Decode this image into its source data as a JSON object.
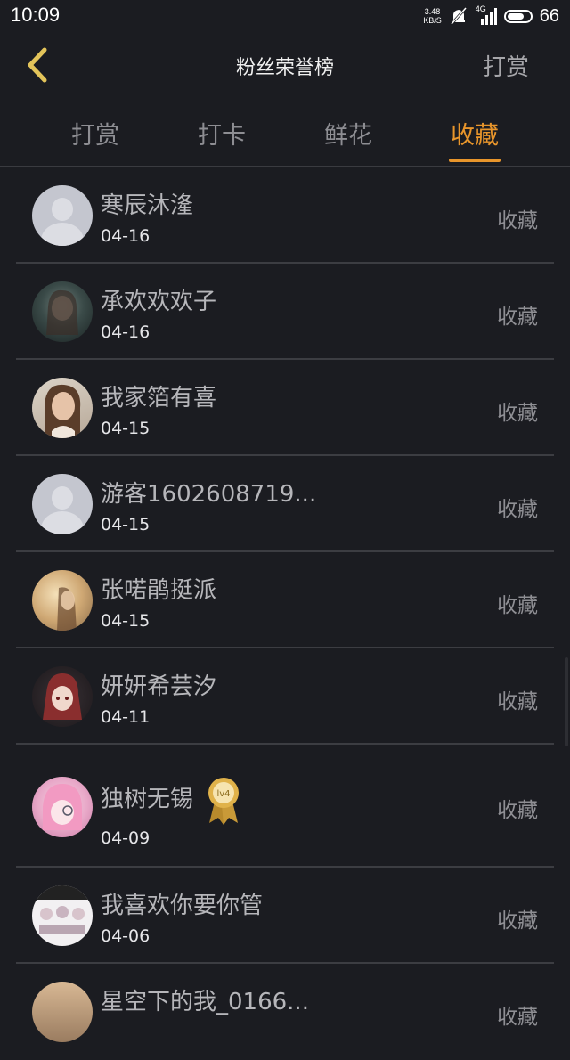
{
  "status": {
    "time": "10:09",
    "net_speed": "3.48",
    "net_unit": "KB/S",
    "network": "4G",
    "battery": "66"
  },
  "nav": {
    "title": "粉丝荣誉榜",
    "right_label": "打赏"
  },
  "tabs": [
    {
      "label": "打赏"
    },
    {
      "label": "打卡"
    },
    {
      "label": "鲜花"
    },
    {
      "label": "收藏"
    }
  ],
  "active_tab": 3,
  "rows": [
    {
      "name": "寒辰沐湰",
      "date": "04-16",
      "action": "收藏",
      "avatar": "default-avatar"
    },
    {
      "name": "承欢欢欢子",
      "date": "04-16",
      "action": "收藏",
      "avatar": "photo-avatar"
    },
    {
      "name": "我家箔有喜",
      "date": "04-15",
      "action": "收藏",
      "avatar": "photo-avatar"
    },
    {
      "name": "游客1602608719...",
      "date": "04-15",
      "action": "收藏",
      "avatar": "default-avatar"
    },
    {
      "name": "张喏鹃挺派",
      "date": "04-15",
      "action": "收藏",
      "avatar": "photo-avatar"
    },
    {
      "name": "妍妍希芸汐",
      "date": "04-11",
      "action": "收藏",
      "avatar": "photo-avatar"
    },
    {
      "name": "独树无锡",
      "date": "04-09",
      "action": "收藏",
      "avatar": "photo-avatar",
      "badge": "lv4"
    },
    {
      "name": "我喜欢你要你管",
      "date": "04-06",
      "action": "收藏",
      "avatar": "photo-avatar"
    },
    {
      "name": "星空下的我_0166...",
      "date": "",
      "action": "收藏",
      "avatar": "photo-avatar"
    }
  ],
  "colors": {
    "accent": "#e8952b",
    "background": "#1b1c21"
  }
}
